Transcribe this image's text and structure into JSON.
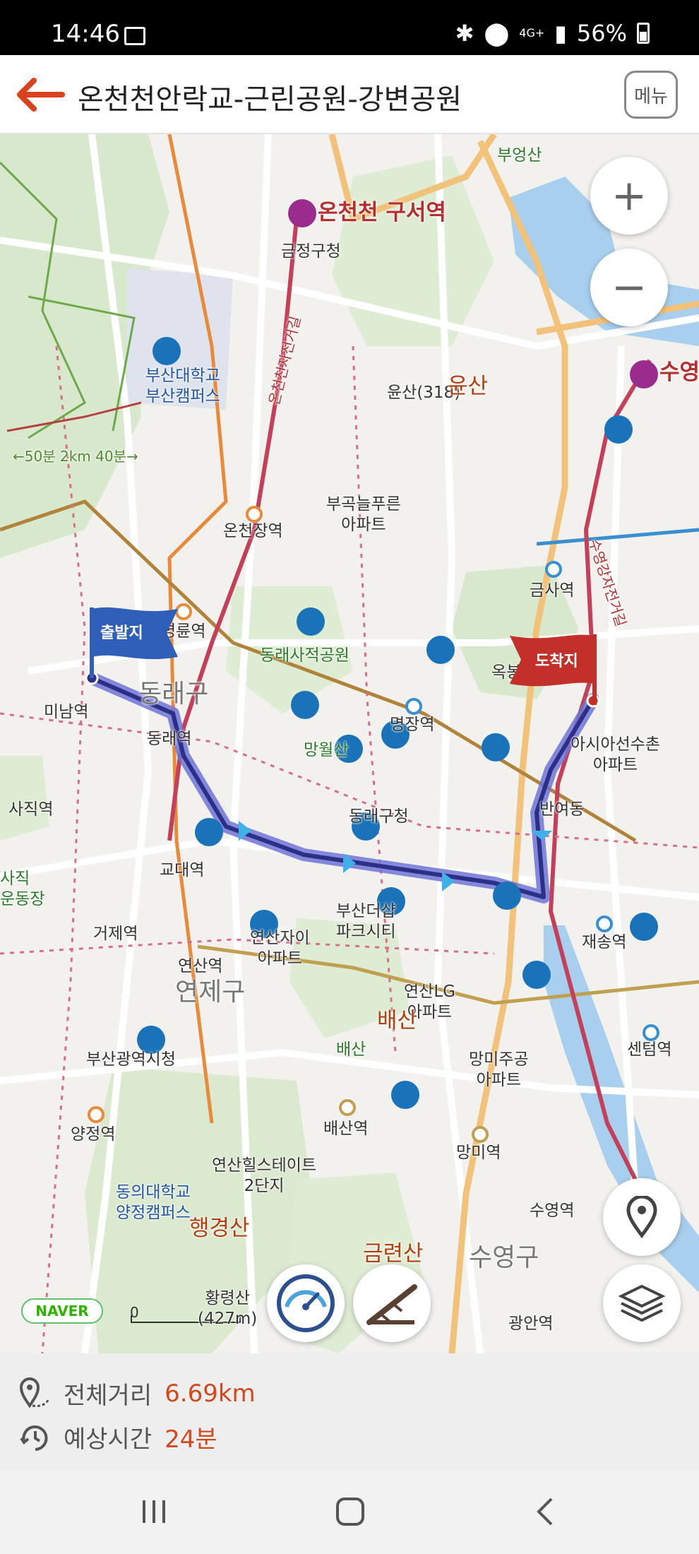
{
  "status_bar": {
    "time": "14:46",
    "network": "4G+",
    "battery": "56%"
  },
  "header": {
    "title": "온천천안락교-근린공원-강변공원",
    "menu_label": "메뉴"
  },
  "map": {
    "zoom_in": "+",
    "zoom_out": "−",
    "start_flag": "출발지",
    "end_flag": "도착지",
    "brand": "NAVER",
    "scale_label": "0",
    "labels": {
      "bueongsan": "부엉산",
      "oncheoncheon_guseo": "온천천 구서역",
      "geumjeong_gucheong": "금정구청",
      "pnu": "부산대학교\n부산캠퍼스",
      "yunsan_peak": "윤산(318)",
      "yunsan": "윤산",
      "suyeong_top": "수영",
      "trail": "←50분 2km 40분→",
      "bugok": "부곡늘푸른\n아파트",
      "oncheonjang": "온천장역",
      "geumsa": "금사역",
      "myeongnyun": "명륜역",
      "dongnae_park": "동래사적공원",
      "okbongsan": "옥봉산",
      "minam": "미남역",
      "dongnae_gu": "동래구",
      "dongnae_st": "동래역",
      "myeongjang": "명장역",
      "mangwol": "망월산",
      "asian": "아시아선수촌\n아파트",
      "sajik": "사직역",
      "dongnae_office": "동래구청",
      "banyeo": "반여동",
      "sajik_stadium": "사직\n운동장",
      "gyodae": "교대역",
      "busan_daeu": "부산더샵\n파크시티",
      "jaesong": "재송역",
      "geoje": "거제역",
      "yeonsan_xi": "연산자이\n아파트",
      "yeonsan": "연산역",
      "yeonje_gu": "연제구",
      "yeonsan_lg": "연산LG\n아파트",
      "baesan": "배산",
      "baesan_small": "배산",
      "busan_cityhall": "부산광역시청",
      "mangmi_apt": "망미주공\n아파트",
      "centum": "센텀역",
      "yangjeong": "양정역",
      "baesan_st": "배산역",
      "mangmi": "망미역",
      "yeonsan_hills": "연산힐스테이트\n2단지",
      "deu": "동의대학교\n양정캠퍼스",
      "haenggyeongsan": "행경산",
      "suyeong_st": "수영역",
      "geumnyeonsan": "금련산",
      "suyeong_gu": "수영구",
      "hwangnyeongsan": "황령산\n(427m)",
      "gwangan": "광안역",
      "suyeonggang_bike": "수영강자전거길",
      "oncheoncheon_bike": "온천천자전거길"
    }
  },
  "info": {
    "distance_label": "전체거리",
    "distance_value": "6.69km",
    "time_label": "예상시간",
    "time_value": "24분"
  },
  "colors": {
    "accent": "#d24a1c",
    "route": "#3a3fa8",
    "start_flag": "#2f5fb8",
    "end_flag": "#c3302a"
  }
}
